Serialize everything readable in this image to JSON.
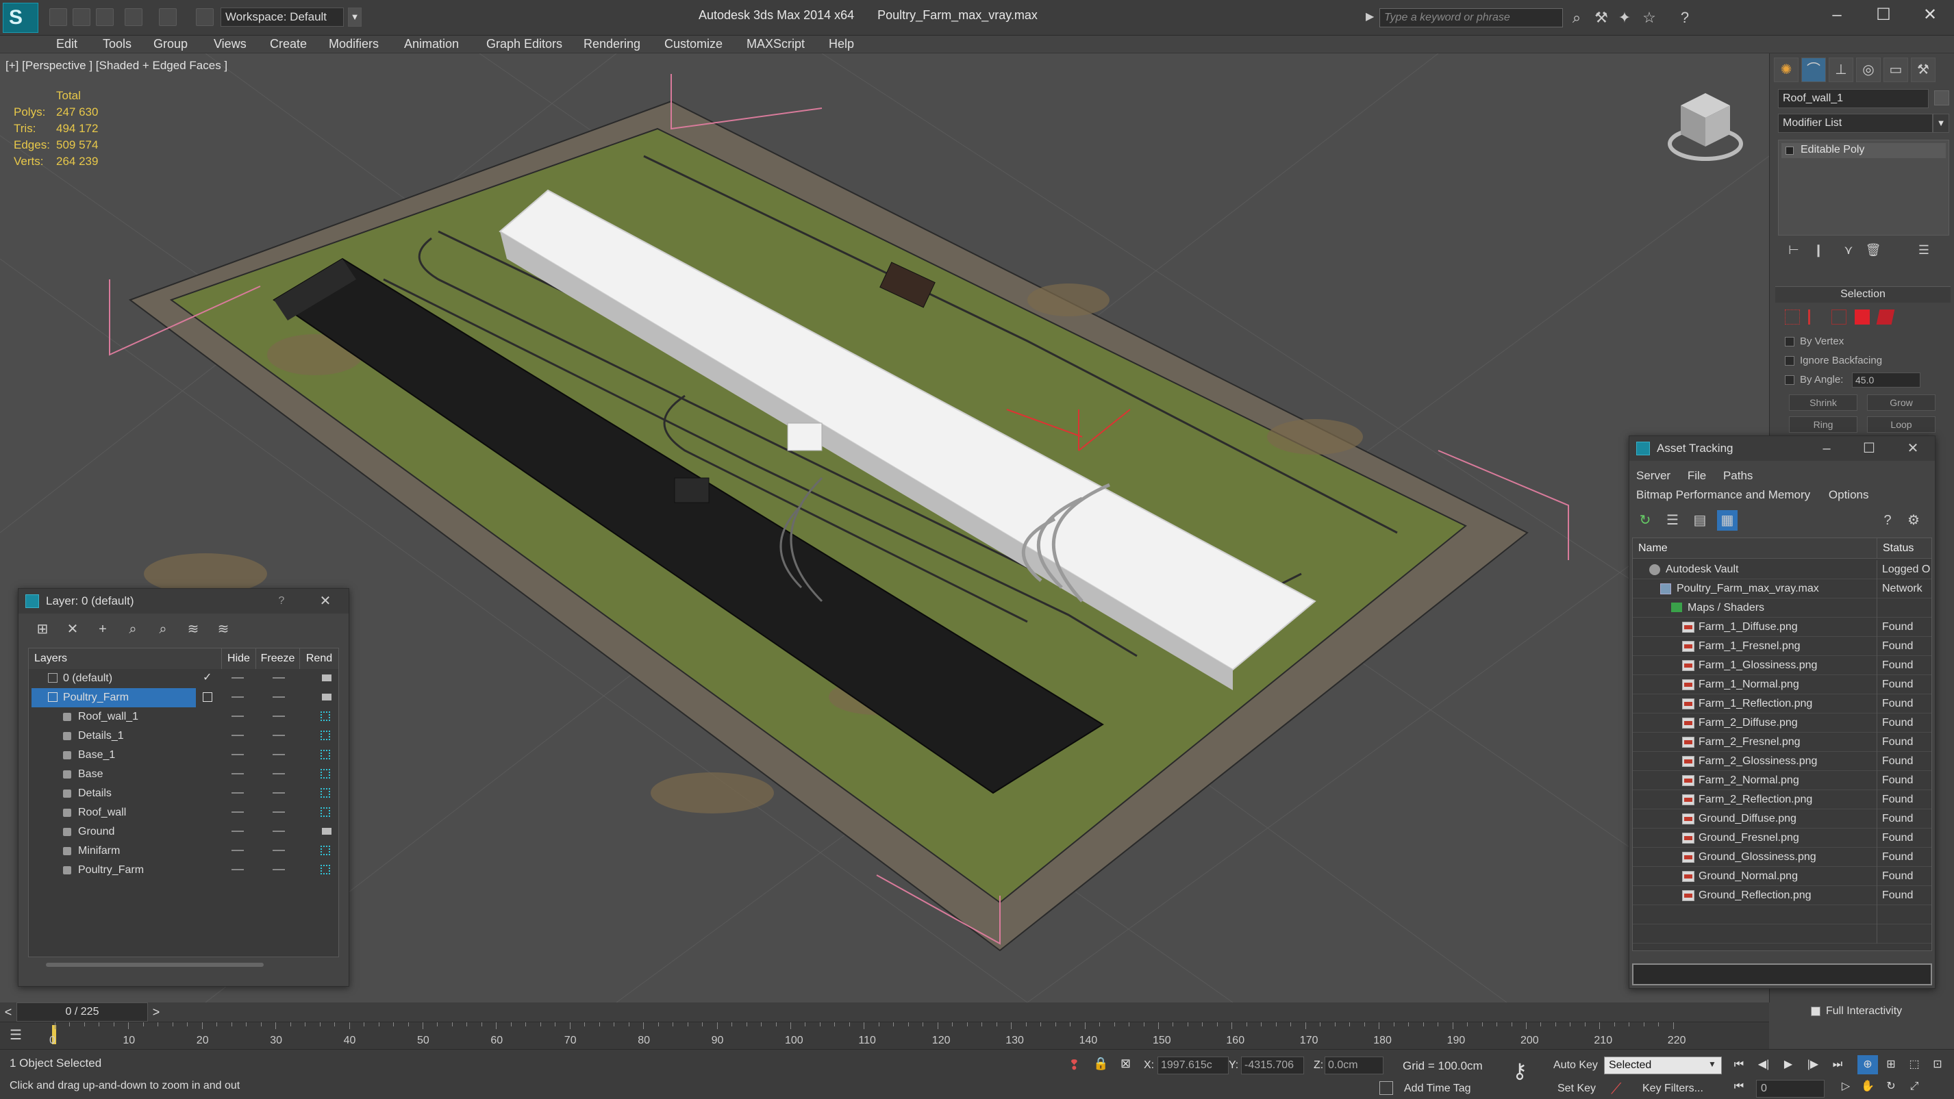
{
  "window": {
    "app_title": "Autodesk 3ds Max  2014 x64",
    "file_name": "Poultry_Farm_max_vray.max",
    "workspace": "Workspace: Default",
    "search_placeholder": "Type a keyword or phrase"
  },
  "menu": [
    "Edit",
    "Tools",
    "Group",
    "Views",
    "Create",
    "Modifiers",
    "Animation",
    "Graph Editors",
    "Rendering",
    "Customize",
    "MAXScript",
    "Help"
  ],
  "viewport": {
    "label": "[+] [Perspective ] [Shaded + Edged Faces ]",
    "stats_header": "Total",
    "stats": [
      {
        "label": "Polys:",
        "value": "247 630"
      },
      {
        "label": "Tris:",
        "value": "494 172"
      },
      {
        "label": "Edges:",
        "value": "509 574"
      },
      {
        "label": "Verts:",
        "value": "264 239"
      }
    ]
  },
  "command_panel": {
    "object_name": "Roof_wall_1",
    "modifier_list": "Modifier List",
    "stack_item": "Editable Poly",
    "selection_title": "Selection",
    "by_vertex": "By Vertex",
    "ignore_backfacing": "Ignore Backfacing",
    "by_angle": "By Angle:",
    "angle_value": "45.0",
    "shrink": "Shrink",
    "grow": "Grow",
    "ring": "Ring",
    "loop": "Loop",
    "full_interactivity": "Full Interactivity"
  },
  "layer_window": {
    "title": "Layer: 0 (default)",
    "help": "?",
    "columns": {
      "layers": "Layers",
      "hide": "Hide",
      "freeze": "Freeze",
      "render": "Rend"
    },
    "rows": [
      {
        "name": "0 (default)",
        "type": "layer",
        "current": true
      },
      {
        "name": "Poultry_Farm",
        "type": "layer",
        "selected": true
      },
      {
        "name": "Roof_wall_1",
        "type": "object"
      },
      {
        "name": "Details_1",
        "type": "object"
      },
      {
        "name": "Base_1",
        "type": "object"
      },
      {
        "name": "Base",
        "type": "object"
      },
      {
        "name": "Details",
        "type": "object"
      },
      {
        "name": "Roof_wall",
        "type": "object"
      },
      {
        "name": "Ground",
        "type": "object"
      },
      {
        "name": "Minifarm",
        "type": "object"
      },
      {
        "name": "Poultry_Farm",
        "type": "object"
      }
    ]
  },
  "asset_window": {
    "title": "Asset Tracking",
    "menu1": [
      "Server",
      "File",
      "Paths"
    ],
    "menu2": [
      "Bitmap Performance and Memory",
      "Options"
    ],
    "columns": {
      "name": "Name",
      "status": "Status"
    },
    "rows": [
      {
        "name": "Autodesk Vault",
        "status": "Logged O",
        "indent": 1,
        "kind": "vault"
      },
      {
        "name": "Poultry_Farm_max_vray.max",
        "status": "Network",
        "indent": 2,
        "kind": "max"
      },
      {
        "name": "Maps / Shaders",
        "status": "",
        "indent": 3,
        "kind": "folder"
      },
      {
        "name": "Farm_1_Diffuse.png",
        "status": "Found",
        "indent": 4,
        "kind": "png"
      },
      {
        "name": "Farm_1_Fresnel.png",
        "status": "Found",
        "indent": 4,
        "kind": "png"
      },
      {
        "name": "Farm_1_Glossiness.png",
        "status": "Found",
        "indent": 4,
        "kind": "png"
      },
      {
        "name": "Farm_1_Normal.png",
        "status": "Found",
        "indent": 4,
        "kind": "png"
      },
      {
        "name": "Farm_1_Reflection.png",
        "status": "Found",
        "indent": 4,
        "kind": "png"
      },
      {
        "name": "Farm_2_Diffuse.png",
        "status": "Found",
        "indent": 4,
        "kind": "png"
      },
      {
        "name": "Farm_2_Fresnel.png",
        "status": "Found",
        "indent": 4,
        "kind": "png"
      },
      {
        "name": "Farm_2_Glossiness.png",
        "status": "Found",
        "indent": 4,
        "kind": "png"
      },
      {
        "name": "Farm_2_Normal.png",
        "status": "Found",
        "indent": 4,
        "kind": "png"
      },
      {
        "name": "Farm_2_Reflection.png",
        "status": "Found",
        "indent": 4,
        "kind": "png"
      },
      {
        "name": "Ground_Diffuse.png",
        "status": "Found",
        "indent": 4,
        "kind": "png"
      },
      {
        "name": "Ground_Fresnel.png",
        "status": "Found",
        "indent": 4,
        "kind": "png"
      },
      {
        "name": "Ground_Glossiness.png",
        "status": "Found",
        "indent": 4,
        "kind": "png"
      },
      {
        "name": "Ground_Normal.png",
        "status": "Found",
        "indent": 4,
        "kind": "png"
      },
      {
        "name": "Ground_Reflection.png",
        "status": "Found",
        "indent": 4,
        "kind": "png"
      }
    ]
  },
  "timeline": {
    "slider": "0 / 225",
    "prev": "<",
    "next": ">",
    "ticks": [
      "0",
      "10",
      "20",
      "30",
      "40",
      "50",
      "60",
      "70",
      "80",
      "90",
      "100",
      "110",
      "120",
      "130",
      "140",
      "150",
      "160",
      "170",
      "180",
      "190",
      "200",
      "210",
      "220"
    ]
  },
  "status": {
    "selection": "1 Object Selected",
    "prompt": "Click and drag up-and-down to zoom in and out",
    "x_label": "X:",
    "x_value": "1997.615c",
    "y_label": "Y:",
    "y_value": "-4315.706",
    "z_label": "Z:",
    "z_value": "0.0cm",
    "grid": "Grid = 100.0cm",
    "add_time_tag": "Add Time Tag",
    "auto_key": "Auto Key",
    "set_key": "Set Key",
    "selected": "Selected",
    "key_filters": "Key Filters...",
    "frame": "0"
  },
  "colors": {
    "selection_blue": "#2f73b8",
    "grass": "#6a7a3a",
    "pink_bounds": "#d97b9b",
    "accent": "#1a8aa0"
  }
}
